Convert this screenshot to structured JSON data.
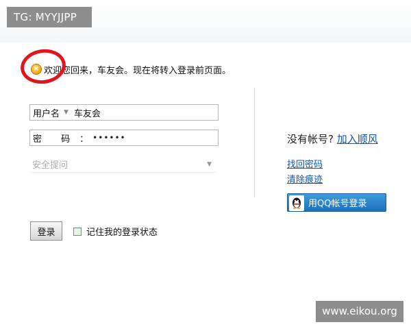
{
  "overlays": {
    "tg_badge": "TG: MYYJJPP",
    "watermark": "www.eikou.org"
  },
  "welcome": {
    "icon": "info-circle-icon",
    "message": "欢迎您回来，车友会。现在将转入登录前页面。"
  },
  "form": {
    "username": {
      "label": "用户名",
      "value": "车友会"
    },
    "password": {
      "label": "密 码",
      "colon": "：",
      "value": "••••••"
    },
    "security_question": {
      "placeholder": "安全提问"
    },
    "login_button": "登录",
    "remember_label": "记住我的登录状态"
  },
  "side": {
    "no_account_text": "没有帐号?",
    "register_link": "加入顺风",
    "forgot_password": "找回密码",
    "clear_traces": "清除痕迹",
    "qq_login": "用QQ帐号登录"
  },
  "colors": {
    "link": "#1256a8",
    "qq_button": "#1d6fbd",
    "annotation_circle": "#e0161e"
  }
}
